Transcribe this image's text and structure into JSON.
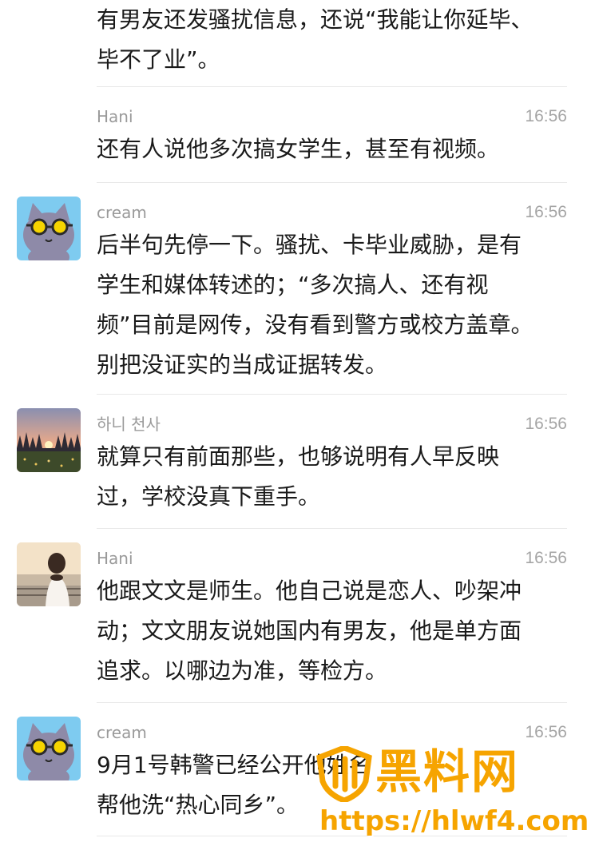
{
  "top_message": {
    "lines": [
      "有男友还发骚扰信息，还说“我能让你延毕、",
      "毕不了业”。"
    ]
  },
  "messages": [
    {
      "name": "Hani",
      "time": "16:56",
      "avatar": "none",
      "lines": [
        "还有人说他多次搞女学生，甚至有视频。"
      ]
    },
    {
      "name": "cream",
      "time": "16:56",
      "avatar": "cat-sunglasses-avatar",
      "lines": [
        "后半句先停一下。骚扰、卡毕业威胁，是有",
        "学生和媒体转述的；“多次搞人、还有视",
        "频”目前是网传，没有看到警方或校方盖章。",
        "别把没证实的当成证据转发。"
      ]
    },
    {
      "name": "하니 천사",
      "time": "16:56",
      "avatar": "sunset-field-avatar",
      "lines": [
        "就算只有前面那些，也够说明有人早反映",
        "过，学校没真下重手。"
      ]
    },
    {
      "name": "Hani",
      "time": "16:56",
      "avatar": "girl-seaside-avatar",
      "lines": [
        "他跟文文是师生。他自己说是恋人、吵架冲",
        "动；文文朋友说她国内有男友，他是单方面",
        "追求。以哪边为准，等检方。"
      ]
    },
    {
      "name": "cream",
      "time": "16:56",
      "avatar": "cat-sunglasses-avatar",
      "lines": [
        "9月1号韩警已经公开他姓名",
        "帮他洗“热心同乡”。"
      ]
    }
  ],
  "watermark": {
    "title": "黑料网",
    "url": "https://hlwf4.com",
    "color": "#f6a400"
  },
  "colors": {
    "text": "#1a1a1a",
    "meta": "#a5a5a5",
    "divider": "#e8e8e8"
  }
}
